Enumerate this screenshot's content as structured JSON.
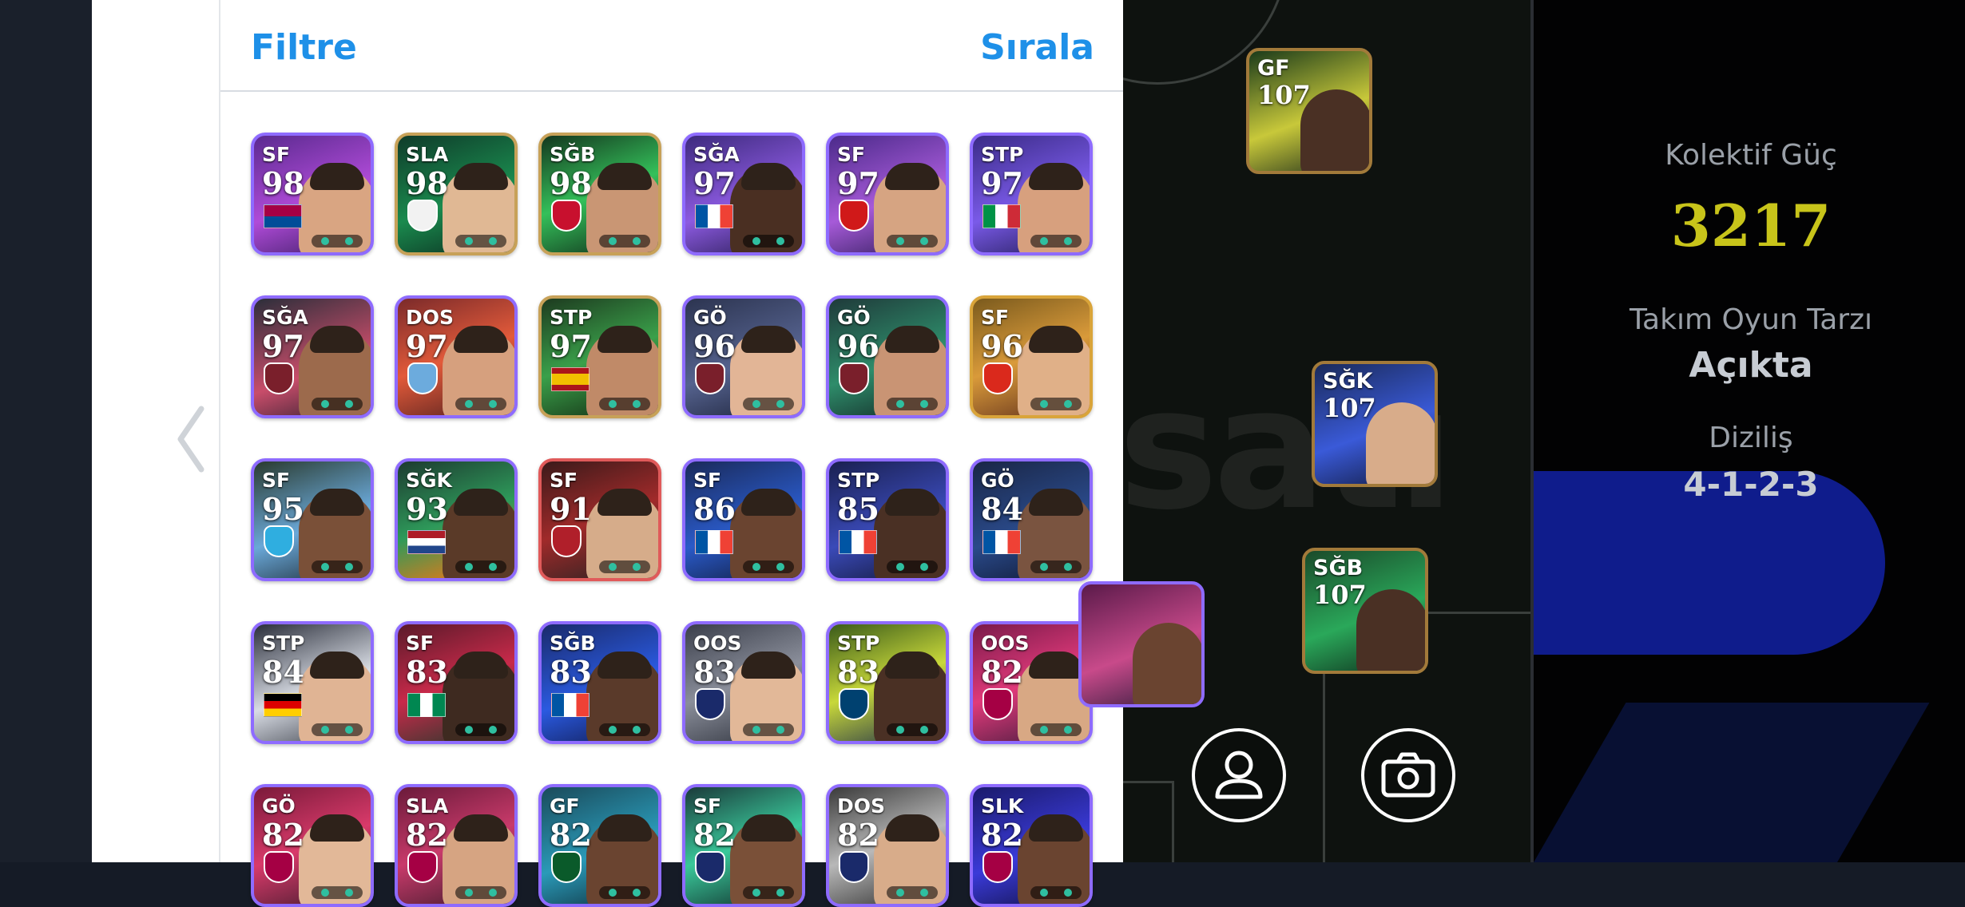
{
  "filter_panel": {
    "filter_label": "Filtre",
    "sort_label": "Sırala",
    "cards": [
      {
        "pos": "SF",
        "ovr": "98",
        "border": "#8e6bff",
        "bg": "linear-gradient(160deg,#5a2a8f,#b04bd8 55%,#3a1d63)",
        "mark": "flag",
        "mc": "linear-gradient(#a50044 50%,#004d98 50%)",
        "skin": "#d9a582"
      },
      {
        "pos": "SLA",
        "ovr": "98",
        "border": "#c7a158",
        "bg": "linear-gradient(160deg,#0f3b2a,#1a8a4e 55%,#0b2a1e)",
        "mark": "badge",
        "mc": "#f2f2f2",
        "skin": "#e0b894"
      },
      {
        "pos": "SĞB",
        "ovr": "98",
        "border": "#c7a158",
        "bg": "linear-gradient(160deg,#14361e,#34c05a 50%,#0e2416)",
        "mark": "badge",
        "mc": "#c8102e",
        "skin": "#c99674"
      },
      {
        "pos": "SĞA",
        "ovr": "97",
        "border": "#8e6bff",
        "bg": "linear-gradient(160deg,#3d2a7d,#8c5ae0 55%,#241a4e)",
        "mark": "flag",
        "mc": "linear-gradient(90deg,#0055a4 33%,#fff 33%,#fff 66%,#ef4135 66%)",
        "skin": "#4a2f22"
      },
      {
        "pos": "SF",
        "ovr": "97",
        "border": "#8e6bff",
        "bg": "linear-gradient(160deg,#4b2a8a,#a65ad8 55%,#2a1a55)",
        "mark": "badge",
        "mc": "#d01919",
        "skin": "#d6a482"
      },
      {
        "pos": "STP",
        "ovr": "97",
        "border": "#8e6bff",
        "bg": "linear-gradient(160deg,#3a2b86,#7a5ae8 55%,#1f1a52)",
        "mark": "flag",
        "mc": "linear-gradient(90deg,#009246 33%,#fff 33%,#fff 66%,#ce2b37 66%)",
        "skin": "#d7a07e"
      },
      {
        "pos": "SĞA",
        "ovr": "97",
        "border": "#8e6bff",
        "bg": "linear-gradient(160deg,#2b2e3a,#c84d6a 60%,#2a1e2e)",
        "mark": "badge",
        "mc": "#7a1f2b",
        "skin": "#9c6a4c"
      },
      {
        "pos": "DOS",
        "ovr": "97",
        "border": "#8e6bff",
        "bg": "linear-gradient(160deg,#7a2a2a,#e25a3a 50%,#4a1d1d)",
        "mark": "badge",
        "mc": "#6cabdd",
        "skin": "#d6a07e"
      },
      {
        "pos": "STP",
        "ovr": "97",
        "border": "#c7a158",
        "bg": "linear-gradient(160deg,#1d3a1f,#3aa04a 50%,#10240f)",
        "mark": "flag",
        "mc": "linear-gradient(#aa151b 25%,#f1bf00 25%,#f1bf00 75%,#aa151b 75%)",
        "skin": "#c08a68"
      },
      {
        "pos": "GÖ",
        "ovr": "96",
        "border": "#8e6bff",
        "bg": "linear-gradient(160deg,#2c3450,#55628e 55%,#1a2036)",
        "mark": "badge",
        "mc": "#7a1f2b",
        "skin": "#e2b596"
      },
      {
        "pos": "GÖ",
        "ovr": "96",
        "border": "#8e6bff",
        "bg": "linear-gradient(160deg,#1f3a3a,#2e8c6a 55%,#122222)",
        "mark": "badge",
        "mc": "#7a1f2b",
        "skin": "#c99474"
      },
      {
        "pos": "SF",
        "ovr": "96",
        "border": "#d9a43a",
        "bg": "linear-gradient(160deg,#7a5a1d,#d99a3a 50%,#5a2a1a)",
        "mark": "badge",
        "mc": "#da291c",
        "skin": "#e0b088"
      },
      {
        "pos": "SF",
        "ovr": "95",
        "border": "#8e6bff",
        "bg": "linear-gradient(160deg,#2a3a2e,#6aa8d8 55%,#1a2630)",
        "mark": "badge",
        "mc": "#2faee0",
        "skin": "#7a5038"
      },
      {
        "pos": "SĞK",
        "ovr": "93",
        "border": "#8e6bff",
        "bg": "linear-gradient(160deg,#1d3a30,#2e9a5a 50%,#e07a1a 90%)",
        "mark": "flag",
        "mc": "linear-gradient(#ae1c28 33%,#fff 33%,#fff 66%,#21468b 66%)",
        "skin": "#5a3a28"
      },
      {
        "pos": "SF",
        "ovr": "91",
        "border": "#e05a5a",
        "bg": "linear-gradient(160deg,#3a1a1a,#a02a2a 50%,#222)",
        "mark": "badge",
        "mc": "#b01f2a",
        "skin": "#d6ac8a"
      },
      {
        "pos": "SF",
        "ovr": "86",
        "border": "#8e6bff",
        "bg": "linear-gradient(160deg,#1a2a5a,#2a5ac8 55%,#101a3a)",
        "mark": "flag",
        "mc": "linear-gradient(90deg,#0055a4 33%,#fff 33%,#fff 66%,#ef4135 66%)",
        "skin": "#6a4430"
      },
      {
        "pos": "STP",
        "ovr": "85",
        "border": "#8e6bff",
        "bg": "linear-gradient(160deg,#1a2050,#3a4ab8 55%,#121636)",
        "mark": "flag",
        "mc": "linear-gradient(90deg,#0055a4 33%,#fff 33%,#fff 66%,#ef4135 66%)",
        "skin": "#4a3024"
      },
      {
        "pos": "GÖ",
        "ovr": "84",
        "border": "#8e6bff",
        "bg": "linear-gradient(160deg,#1a2646,#2a4a8a 55%,#0e1630)",
        "mark": "flag",
        "mc": "linear-gradient(90deg,#0055a4 33%,#fff 33%,#fff 66%,#ef4135 66%)",
        "skin": "#7a5440"
      },
      {
        "pos": "STP",
        "ovr": "84",
        "border": "#8e6bff",
        "bg": "linear-gradient(160deg,#2a2e3a,#d8dce4 55%,#3a3e48)",
        "mark": "flag",
        "mc": "linear-gradient(#000 33%,#dd0000 33%,#dd0000 66%,#ffce00 66%)",
        "skin": "#e0b494"
      },
      {
        "pos": "SF",
        "ovr": "83",
        "border": "#8e6bff",
        "bg": "linear-gradient(160deg,#5a1a2a,#c82a4a 50%,#1a3a2a)",
        "mark": "flag",
        "mc": "linear-gradient(90deg,#008751 33%,#fff 33%,#fff 66%,#008751 66%)",
        "skin": "#3e2a20"
      },
      {
        "pos": "SĞB",
        "ovr": "83",
        "border": "#8e6bff",
        "bg": "linear-gradient(160deg,#1a2a6a,#2a5ae0 55%,#10184a)",
        "mark": "flag",
        "mc": "linear-gradient(90deg,#0055a4 33%,#fff 33%,#fff 66%,#ef4135 66%)",
        "skin": "#5a3a2a"
      },
      {
        "pos": "OOS",
        "ovr": "83",
        "border": "#8e6bff",
        "bg": "linear-gradient(160deg,#3a3e4a,#8a8e9a 50%,#2a2e38)",
        "mark": "badge",
        "mc": "#1a2a6a",
        "skin": "#e2b898"
      },
      {
        "pos": "STP",
        "ovr": "83",
        "border": "#8e6bff",
        "bg": "linear-gradient(160deg,#3a5a1a,#c8d83a 50%,#1a2a4a)",
        "mark": "badge",
        "mc": "#004170",
        "skin": "#4a3024"
      },
      {
        "pos": "OOS",
        "ovr": "82",
        "border": "#8e6bff",
        "bg": "linear-gradient(160deg,#7a1a4a,#e03a7a 50%,#3a1a3a)",
        "mark": "badge",
        "mc": "#a50044",
        "skin": "#d8a884"
      },
      {
        "pos": "GÖ",
        "ovr": "82",
        "border": "#8e6bff",
        "bg": "linear-gradient(160deg,#7a1a3a,#d83a6a 50%,#3a1a2a)",
        "mark": "badge",
        "mc": "#a50044",
        "skin": "#e2b898"
      },
      {
        "pos": "SLA",
        "ovr": "82",
        "border": "#8e6bff",
        "bg": "linear-gradient(160deg,#6a1a3a,#c83a6a 50%,#3a1a2a)",
        "mark": "badge",
        "mc": "#a50044",
        "skin": "#d6a482"
      },
      {
        "pos": "GF",
        "ovr": "82",
        "border": "#8e6bff",
        "bg": "linear-gradient(160deg,#1a4a5a,#2a9ab8 55%,#0e2a36)",
        "mark": "badge",
        "mc": "#0a5a2a",
        "skin": "#6a4430"
      },
      {
        "pos": "SF",
        "ovr": "82",
        "border": "#8e6bff",
        "bg": "linear-gradient(160deg,#1a3a3a,#3ac89a 50%,#0e2424)",
        "mark": "badge",
        "mc": "#1a2a6a",
        "skin": "#7a5038"
      },
      {
        "pos": "DOS",
        "ovr": "82",
        "border": "#8e6bff",
        "bg": "linear-gradient(160deg,#3a3a3a,#b8b8b8 50%,#2a2a2a)",
        "mark": "badge",
        "mc": "#1a2a6a",
        "skin": "#d8ac8a"
      },
      {
        "pos": "SLK",
        "ovr": "82",
        "border": "#8e6bff",
        "bg": "linear-gradient(160deg,#1a1a6a,#3a3ad8 55%,#101040)",
        "mark": "badge",
        "mc": "#a50044",
        "skin": "#6a4430"
      }
    ]
  },
  "pitch": {
    "watermark": "satı",
    "players": [
      {
        "pos": "GF",
        "ovr": "107",
        "border": "#a27a3a",
        "bg": "linear-gradient(160deg,#1a3a1a,#c8c83a 55%,#1a2a1a)",
        "skin": "#4a3024"
      },
      {
        "pos": "SĞK",
        "ovr": "107",
        "border": "#a27a3a",
        "bg": "linear-gradient(160deg,#1a2a5a,#3a5ad8 55%,#10183a)",
        "skin": "#d8ac8a"
      },
      {
        "pos": "SĞB",
        "ovr": "107",
        "border": "#a27a3a",
        "bg": "linear-gradient(160deg,#1a4a2a,#2aa85a 55%,#0e2a1a)",
        "skin": "#4a3024"
      }
    ]
  },
  "team_info": {
    "collective_power_label": "Kolektif Güç",
    "collective_power_value": "3217",
    "collective_power_color": "#c8c41a",
    "playstyle_label": "Takım Oyun Tarzı",
    "playstyle_value": "Açıkta",
    "formation_label": "Diziliş",
    "formation_value": "4-1-2-3"
  }
}
